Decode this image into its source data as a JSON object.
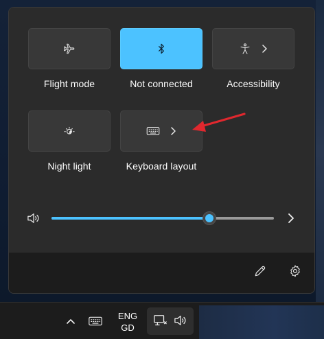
{
  "quick_settings": {
    "tiles": [
      {
        "id": "flight-mode",
        "label": "Flight mode",
        "icon": "airplane-icon",
        "active": false,
        "has_submenu": false
      },
      {
        "id": "bluetooth",
        "label": "Not connected",
        "icon": "bluetooth-icon",
        "active": true,
        "has_submenu": false
      },
      {
        "id": "accessibility",
        "label": "Accessibility",
        "icon": "accessibility-icon",
        "active": false,
        "has_submenu": true
      },
      {
        "id": "night-light",
        "label": "Night light",
        "icon": "brightness-icon",
        "active": false,
        "has_submenu": false
      },
      {
        "id": "keyboard-layout",
        "label": "Keyboard layout",
        "icon": "keyboard-icon",
        "active": false,
        "has_submenu": true
      }
    ],
    "volume": {
      "level_percent": 71,
      "icon": "speaker-icon"
    },
    "footer": {
      "edit_icon": "pencil-icon",
      "settings_icon": "gear-icon"
    }
  },
  "taskbar": {
    "language_line1": "ENG",
    "language_line2": "GD"
  },
  "colors": {
    "accent": "#4cc2ff",
    "flyout_bg": "#2b2b2b",
    "tile_bg": "#383838",
    "annotation_arrow": "#e0282e"
  }
}
